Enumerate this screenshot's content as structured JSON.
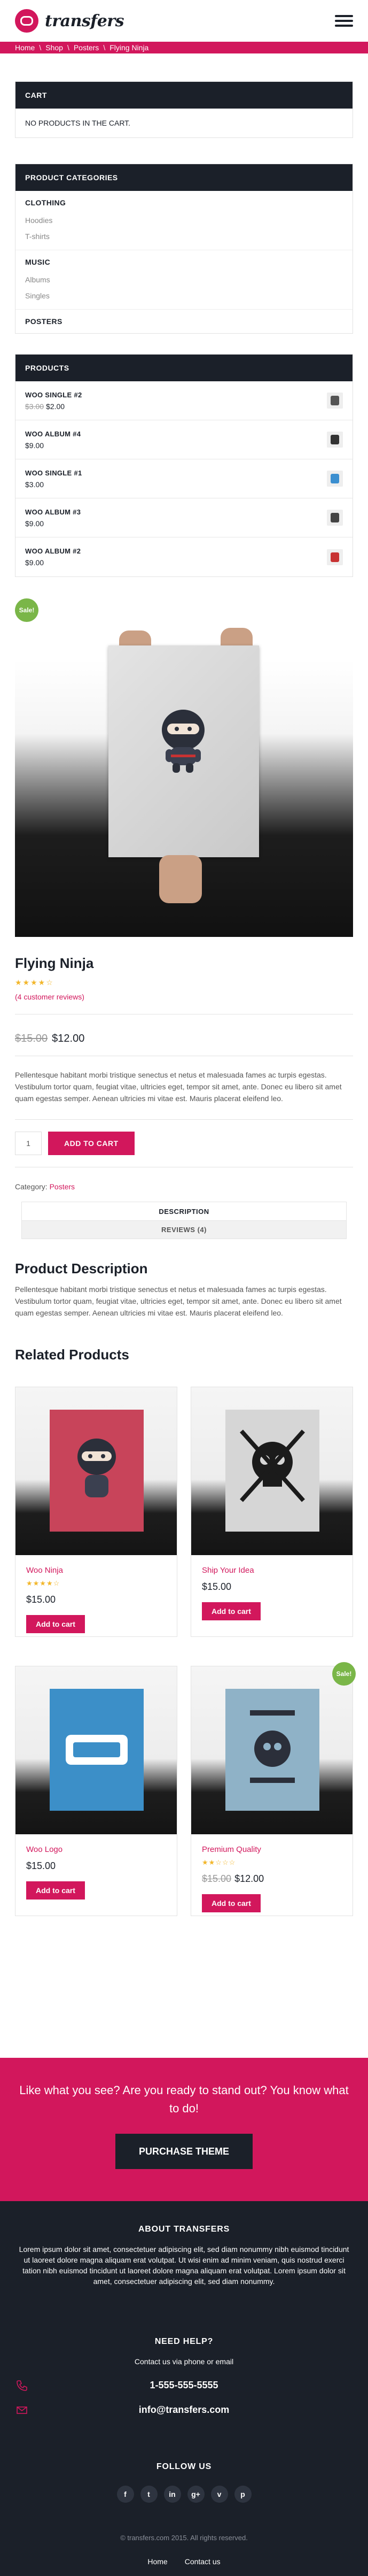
{
  "header": {
    "logo_text": "transfers"
  },
  "breadcrumb": {
    "items": [
      "Home",
      "Shop",
      "Posters",
      "Flying Ninja"
    ],
    "separator": "\\"
  },
  "cart_widget": {
    "title": "CART",
    "empty_text": "NO PRODUCTS IN THE CART."
  },
  "categories_widget": {
    "title": "PRODUCT CATEGORIES",
    "groups": [
      {
        "name": "CLOTHING",
        "subs": [
          "Hoodies",
          "T-shirts"
        ]
      },
      {
        "name": "MUSIC",
        "subs": [
          "Albums",
          "Singles"
        ]
      },
      {
        "name": "POSTERS",
        "subs": []
      }
    ]
  },
  "products_widget": {
    "title": "PRODUCTS",
    "items": [
      {
        "name": "WOO SINGLE #2",
        "old_price": "$3.00",
        "price": "$2.00",
        "thumb_color": "#555555"
      },
      {
        "name": "WOO ALBUM #4",
        "old_price": "",
        "price": "$9.00",
        "thumb_color": "#333333"
      },
      {
        "name": "WOO SINGLE #1",
        "old_price": "",
        "price": "$3.00",
        "thumb_color": "#3b8fd0"
      },
      {
        "name": "WOO ALBUM #3",
        "old_price": "",
        "price": "$9.00",
        "thumb_color": "#444444"
      },
      {
        "name": "WOO ALBUM #2",
        "old_price": "",
        "price": "$9.00",
        "thumb_color": "#c83232"
      }
    ]
  },
  "product": {
    "sale_badge": "Sale!",
    "title": "Flying Ninja",
    "rating_stars": "★★★★☆",
    "rating": 4,
    "reviews_link": "(4 customer reviews)",
    "old_price": "$15.00",
    "price": "$12.00",
    "description": "Pellentesque habitant morbi tristique senectus et netus et malesuada fames ac turpis egestas. Vestibulum tortor quam, feugiat vitae, ultricies eget, tempor sit amet, ante. Donec eu libero sit amet quam egestas semper. Aenean ultricies mi vitae est. Mauris placerat eleifend leo.",
    "qty": "1",
    "add_to_cart": "ADD TO CART",
    "category_label": "Category:",
    "category_value": "Posters"
  },
  "tabs": [
    {
      "label": "DESCRIPTION"
    },
    {
      "label": "REVIEWS (4)"
    }
  ],
  "description_section": {
    "heading": "Product Description",
    "text": "Pellentesque habitant morbi tristique senectus et netus et malesuada fames ac turpis egestas. Vestibulum tortor quam, feugiat vitae, ultricies eget, tempor sit amet, ante. Donec eu libero sit amet quam egestas semper. Aenean ultricies mi vitae est. Mauris placerat eleifend leo."
  },
  "related": {
    "heading": "Related Products",
    "items": [
      {
        "name": "Woo Ninja",
        "stars": "★★★★☆",
        "old_price": "",
        "price": "$15.00",
        "button": "Add to cart",
        "sale": "",
        "poster_color": "#c8445a",
        "poster_glyph": "ninja"
      },
      {
        "name": "Ship Your Idea",
        "stars": "",
        "old_price": "",
        "price": "$15.00",
        "button": "Add to cart",
        "sale": "",
        "poster_color": "#d6d6d6",
        "poster_glyph": "skull"
      },
      {
        "name": "Woo Logo",
        "stars": "",
        "old_price": "",
        "price": "$15.00",
        "button": "Add to cart",
        "sale": "",
        "poster_color": "#3c8fc8",
        "poster_glyph": "woo"
      },
      {
        "name": "Premium Quality",
        "stars": "★★☆☆☆",
        "old_price": "$15.00",
        "price": "$12.00",
        "button": "Add to cart",
        "sale": "Sale!",
        "poster_color": "#8fb2c7",
        "poster_glyph": "premium"
      }
    ]
  },
  "cta": {
    "text": "Like what you see? Are you ready to stand out? You know what to do!",
    "button": "PURCHASE THEME"
  },
  "footer": {
    "about_title": "ABOUT TRANSFERS",
    "about_text": "Lorem ipsum dolor sit amet, consectetuer adipiscing elit, sed diam nonummy nibh euismod tincidunt ut laoreet dolore magna aliquam erat volutpat. Ut wisi enim ad minim veniam, quis nostrud exerci tation nibh euismod tincidunt ut laoreet dolore magna aliquam erat volutpat. Lorem ipsum dolor sit amet, consectetuer adipiscing elit, sed diam nonummy.",
    "help_title": "NEED HELP?",
    "help_text": "Contact us via phone or email",
    "phone": "1-555-555-5555",
    "email": "info@transfers.com",
    "follow_title": "FOLLOW US",
    "socials": [
      "f",
      "t",
      "in",
      "g+",
      "v",
      "p"
    ],
    "copyright": "© transfers.com 2015. All rights reserved.",
    "links": [
      "Home",
      "Contact us"
    ]
  },
  "colors": {
    "accent": "#d2175c",
    "dark": "#1b2029",
    "sale": "#7ab648",
    "star": "#f2b62a"
  }
}
